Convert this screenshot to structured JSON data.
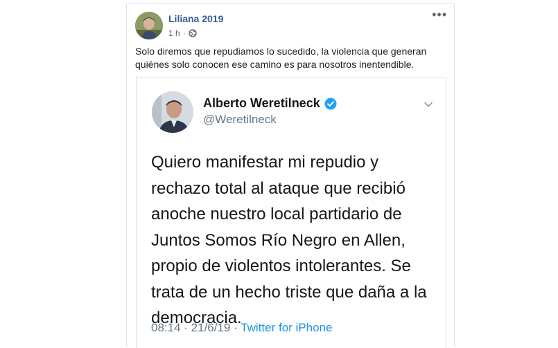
{
  "post": {
    "author": "Liliana 2019",
    "time": "1 h",
    "time_sep": "·",
    "text": "Solo diremos que repudiamos lo sucedido, la violencia que generan quiénes solo conocen ese camino es para nosotros inentendible.",
    "more_icon": "more-horizontal-icon",
    "privacy_icon": "globe-icon"
  },
  "tweet": {
    "name": "Alberto Weretilneck",
    "handle": "@Weretilneck",
    "body": "Quiero manifestar mi repudio y rechazo total al ataque que recibió anoche nuestro local partidario de Juntos Somos Río Negro en Allen, propio de violentos intolerantes. Se trata de un hecho triste que daña a la democracia.",
    "time": "08:14",
    "sep1": " · ",
    "date": "21/6/19",
    "sep2": " · ",
    "source": "Twitter for iPhone",
    "verified_color": "#1da1f2"
  },
  "colors": {
    "link_blue": "#385898",
    "tweet_source": "#1b95e0",
    "border": "#dddfe2"
  }
}
